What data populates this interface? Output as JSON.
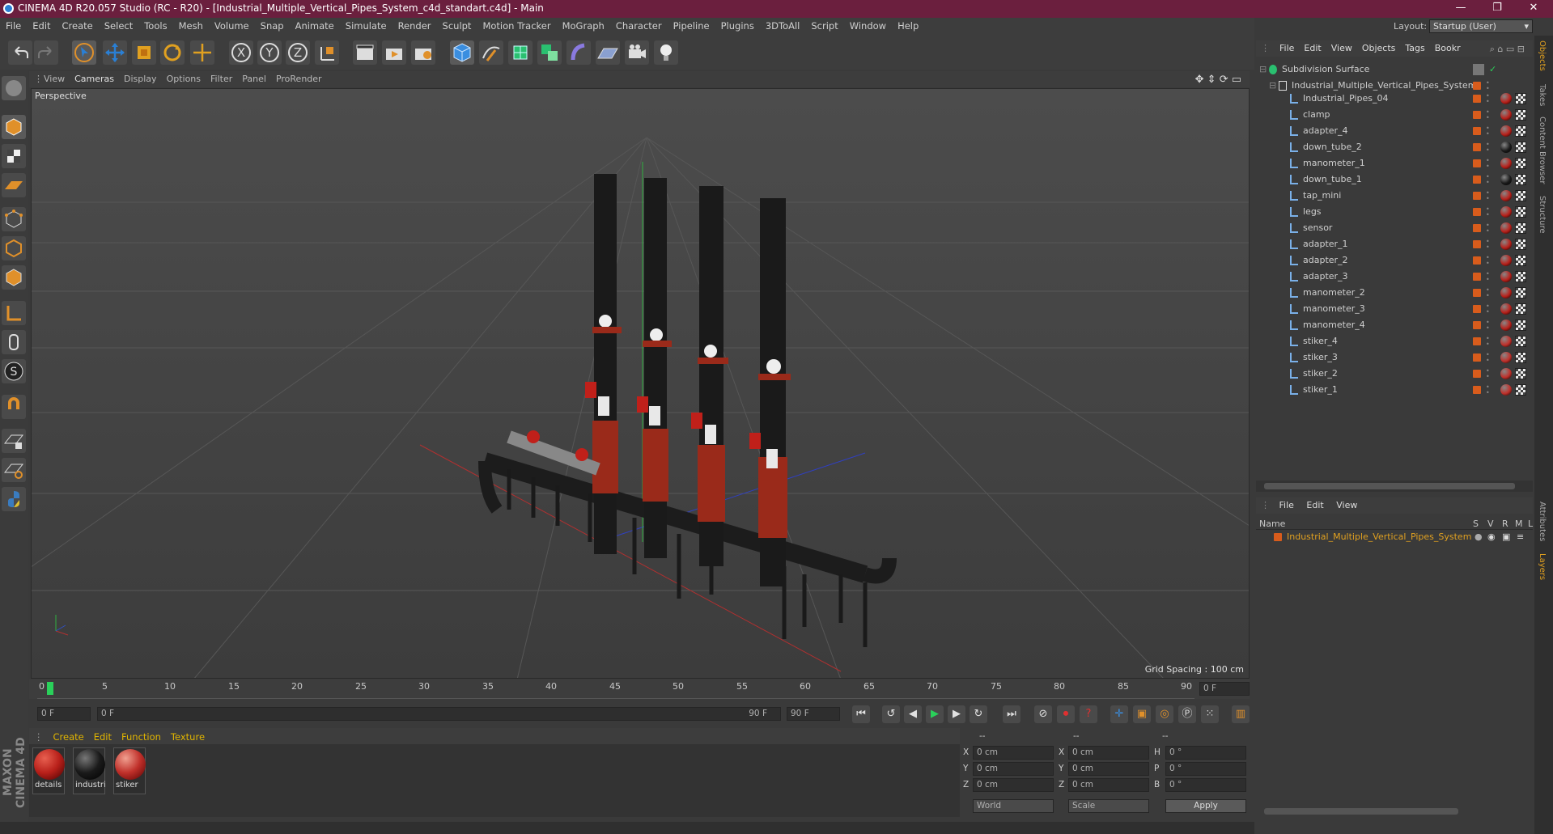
{
  "window": {
    "title": "CINEMA 4D R20.057 Studio (RC - R20) - [Industrial_Multiple_Vertical_Pipes_System_c4d_standart.c4d] - Main"
  },
  "menu": [
    "File",
    "Edit",
    "Create",
    "Select",
    "Tools",
    "Mesh",
    "Volume",
    "Snap",
    "Animate",
    "Simulate",
    "Render",
    "Sculpt",
    "Motion Tracker",
    "MoGraph",
    "Character",
    "Pipeline",
    "Plugins",
    "3DToAll",
    "Script",
    "Window",
    "Help"
  ],
  "layout": {
    "label": "Layout:",
    "value": "Startup (User)"
  },
  "viewport": {
    "menu": [
      "View",
      "Cameras",
      "Display",
      "Options",
      "Filter",
      "Panel",
      "ProRender"
    ],
    "label": "Perspective",
    "grid_spacing": "Grid Spacing : 100 cm"
  },
  "timeline": {
    "ticks": [
      "0",
      "5",
      "10",
      "15",
      "20",
      "25",
      "30",
      "35",
      "40",
      "45",
      "50",
      "55",
      "60",
      "65",
      "70",
      "75",
      "80",
      "85",
      "90"
    ],
    "current": "0 F"
  },
  "transport": {
    "start": "0 F",
    "slider_left": "0 F",
    "slider_right": "90 F",
    "end": "90 F"
  },
  "materials": {
    "menu": [
      "Create",
      "Edit",
      "Function",
      "Texture"
    ],
    "items": [
      {
        "name": "details",
        "color": "#b8201a"
      },
      {
        "name": "industri",
        "color": "#1a1a1a"
      },
      {
        "name": "stiker",
        "color": "#c0302a"
      }
    ]
  },
  "coords": {
    "headers": [
      "--",
      "--",
      "--"
    ],
    "rows": [
      {
        "a": "X",
        "av": "0 cm",
        "b": "X",
        "bv": "0 cm",
        "c": "H",
        "cv": "0 °"
      },
      {
        "a": "Y",
        "av": "0 cm",
        "b": "Y",
        "bv": "0 cm",
        "c": "P",
        "cv": "0 °"
      },
      {
        "a": "Z",
        "av": "0 cm",
        "b": "Z",
        "bv": "0 cm",
        "c": "B",
        "cv": "0 °"
      }
    ],
    "world": "World",
    "scale": "Scale",
    "apply": "Apply"
  },
  "objects": {
    "menu": [
      "File",
      "Edit",
      "View",
      "Objects",
      "Tags",
      "Bookr"
    ],
    "root": "Subdivision Surface",
    "group": "Industrial_Multiple_Vertical_Pipes_System",
    "children": [
      "Industrial_Pipes_04",
      "clamp",
      "adapter_4",
      "down_tube_2",
      "manometer_1",
      "down_tube_1",
      "tap_mini",
      "legs",
      "sensor",
      "adapter_1",
      "adapter_2",
      "adapter_3",
      "manometer_2",
      "manometer_3",
      "manometer_4",
      "stiker_4",
      "stiker_3",
      "stiker_2",
      "stiker_1"
    ],
    "accent": "#d85c1c"
  },
  "layers": {
    "menu": [
      "File",
      "Edit",
      "View"
    ],
    "col_name": "Name",
    "cols": [
      "S",
      "V",
      "R",
      "M",
      "L"
    ],
    "item": "Industrial_Multiple_Vertical_Pipes_System"
  },
  "side_tabs": [
    "Objects",
    "Takes",
    "Content Browser",
    "Structure",
    "Attributes",
    "Layers"
  ]
}
